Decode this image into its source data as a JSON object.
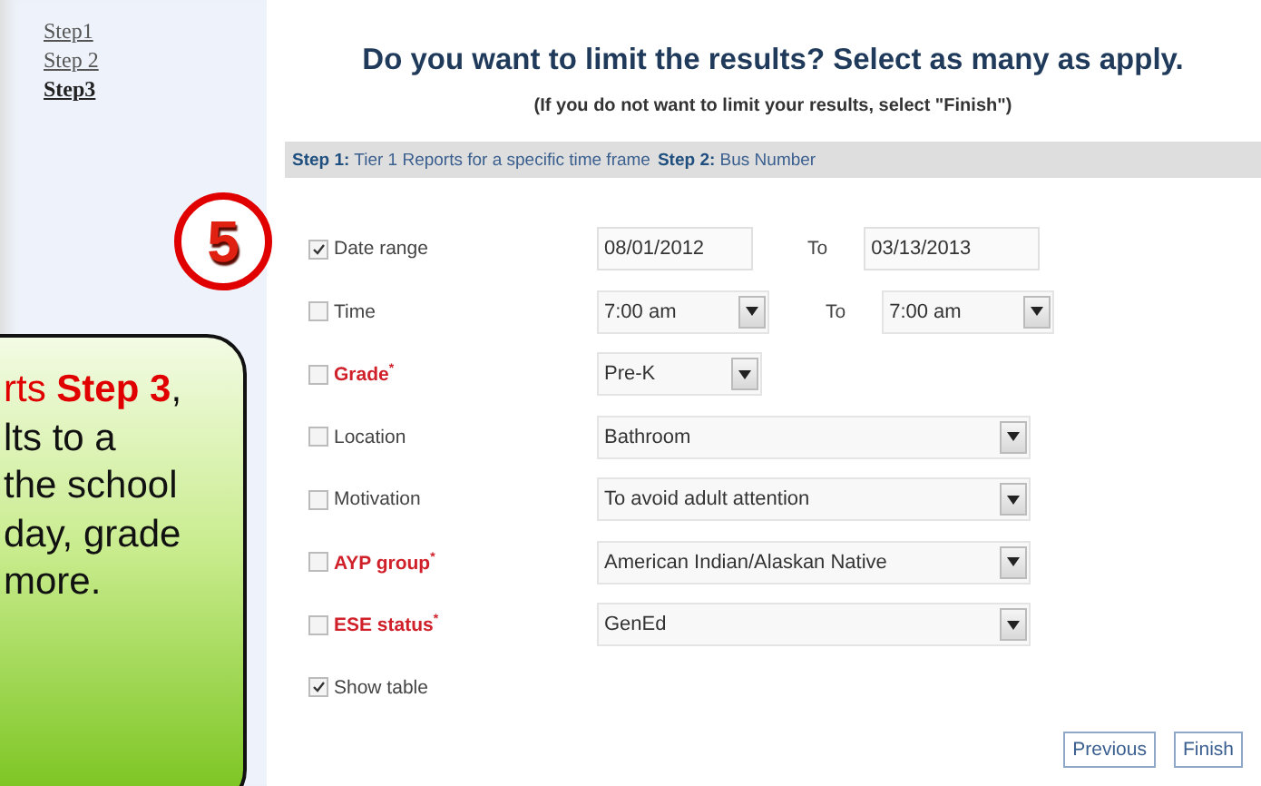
{
  "sidebar": {
    "items": [
      {
        "label": "Step1",
        "selected": false
      },
      {
        "label": "Step 2",
        "selected": false
      },
      {
        "label": "Step3",
        "selected": true
      }
    ]
  },
  "header": {
    "title": "Do you want to limit the results? Select as many as apply.",
    "subtitle": "(If you do not want to limit your results, select \"Finish\")"
  },
  "breadcrumb": [
    {
      "label": "Step 1:",
      "value": "Tier 1 Reports for a specific time frame"
    },
    {
      "label": "Step 2:",
      "value": "Bus Number"
    }
  ],
  "filters": [
    {
      "kind": "dates",
      "label": "Date range",
      "checked": true,
      "required": false,
      "from": "08/01/2012",
      "to_label": "To",
      "to": "03/13/2013"
    },
    {
      "kind": "times",
      "label": "Time",
      "checked": false,
      "required": false,
      "from": "7:00 am",
      "to_label": "To",
      "to": "7:00 am"
    },
    {
      "kind": "short_select",
      "label": "Grade$^{*}$",
      "checked": false,
      "required": true,
      "value": "Pre-K"
    },
    {
      "kind": "select",
      "label": "Location",
      "checked": false,
      "required": false,
      "value": "Bathroom"
    },
    {
      "kind": "select",
      "label": "Motivation",
      "checked": false,
      "required": false,
      "value": "To avoid adult attention"
    },
    {
      "kind": "select",
      "label": "AYP group$^{*}$",
      "checked": false,
      "required": true,
      "value": "American Indian/Alaskan Native"
    },
    {
      "kind": "select",
      "label": "ESE status$^{*}$",
      "checked": false,
      "required": true,
      "value": "GenEd"
    },
    {
      "kind": "checkbox",
      "label": "Show table",
      "checked": true,
      "required": false
    }
  ],
  "buttons": [
    "Previous",
    "Finish"
  ],
  "step_badge": {
    "number": "5"
  },
  "callout": {
    "lines": [
      [
        {
          "text": "rts ",
          "kind": "highlight"
        },
        {
          "text": "Step 3",
          "kind": "highlight_strong"
        },
        {
          "text": ",",
          "kind": "plain"
        }
      ],
      [
        {
          "text": "lts to a",
          "kind": "plain"
        }
      ],
      [
        {
          "text": "the school",
          "kind": "plain"
        }
      ],
      [
        {
          "text": "day, grade",
          "kind": "plain"
        }
      ],
      [
        {
          "text": "more.",
          "kind": "plain"
        }
      ]
    ]
  }
}
